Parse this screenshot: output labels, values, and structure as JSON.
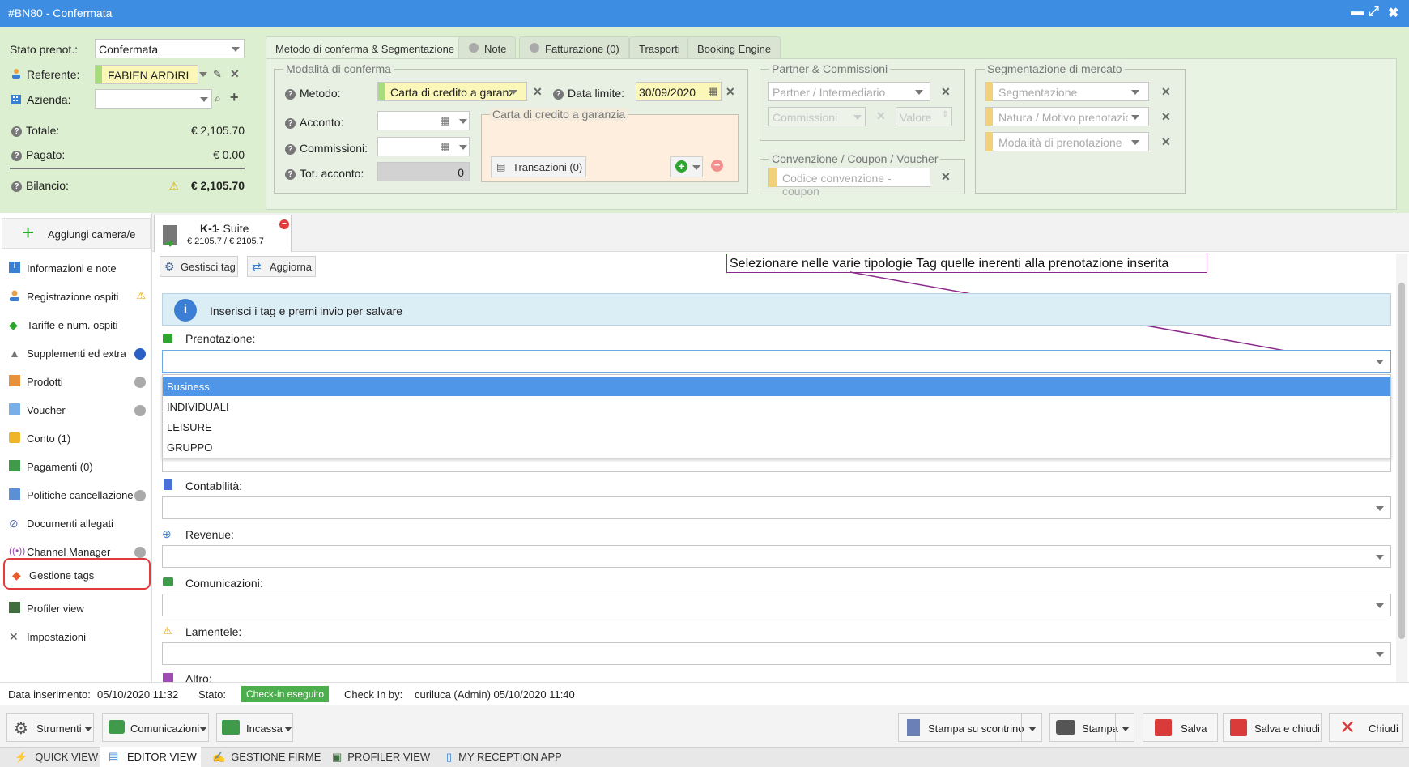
{
  "window": {
    "title": "#BN80 - Confermata",
    "min": "▬",
    "max": "⤢",
    "close": "✖"
  },
  "left_panel": {
    "stato_label": "Stato prenot.:",
    "stato_value": "Confermata",
    "referente_label": "Referente:",
    "referente_value": "FABIEN ARDIRI",
    "azienda_label": "Azienda:",
    "azienda_value": "",
    "totale_label": "Totale:",
    "totale_value": "€ 2,105.70",
    "pagato_label": "Pagato:",
    "pagato_value": "€ 0.00",
    "bilancio_label": "Bilancio:",
    "bilancio_value": "€ 2,105.70"
  },
  "tabs": [
    {
      "label": "Metodo di conferma & Segmentazione"
    },
    {
      "label": "Note"
    },
    {
      "label": "Fatturazione (0)"
    },
    {
      "label": "Trasporti"
    },
    {
      "label": "Booking Engine"
    }
  ],
  "conferma": {
    "legend": "Modalità di conferma",
    "metodo_label": "Metodo:",
    "metodo_value": "Carta di credito a garanzia",
    "data_limite_label": "Data limite:",
    "data_limite_value": "30/09/2020",
    "acconto_label": "Acconto:",
    "commissioni_label": "Commissioni:",
    "tot_acconto_label": "Tot. acconto:",
    "tot_acconto_value": "0",
    "carta_legend": "Carta di credito a garanzia",
    "transazioni_label": "Transazioni (0)"
  },
  "partner": {
    "legend": "Partner & Commissioni",
    "partner_placeholder": "Partner / Intermediario",
    "commissioni_placeholder": "Commissioni",
    "valore_placeholder": "Valore"
  },
  "convenzione": {
    "legend": "Convenzione / Coupon / Voucher",
    "codice_placeholder": "Codice convenzione - coupon"
  },
  "segmentazione": {
    "legend": "Segmentazione di mercato",
    "seg_placeholder": "Segmentazione",
    "natura_placeholder": "Natura / Motivo prenotazione",
    "modalita_placeholder": "Modalità di prenotazione"
  },
  "sidebar": {
    "add_room": "Aggiungi camera/e",
    "items": [
      {
        "label": "Informazioni e note"
      },
      {
        "label": "Registrazione ospiti"
      },
      {
        "label": "Tariffe e num. ospiti"
      },
      {
        "label": "Supplementi ed extra"
      },
      {
        "label": "Prodotti"
      },
      {
        "label": "Voucher"
      },
      {
        "label": "Conto (1)"
      },
      {
        "label": "Pagamenti (0)"
      },
      {
        "label": "Politiche cancellazione"
      },
      {
        "label": "Documenti allegati"
      },
      {
        "label": "Channel Manager"
      },
      {
        "label": "Gestione tags"
      },
      {
        "label": "Profiler view"
      },
      {
        "label": "Impostazioni"
      }
    ]
  },
  "room_tab": {
    "code": "K-1",
    "type": " - Suite",
    "price": "€ 2105.7 / € 2105.7"
  },
  "tags": {
    "gestisci_label": "Gestisci tag",
    "aggiorna_label": "Aggiorna",
    "annotation": "Selezionare nelle varie tipologie Tag quelle inerenti alla prenotazione inserita",
    "info": "Inserisci i tag e premi invio per salvare",
    "prenotazione_label": "Prenotazione:",
    "options": [
      "Business",
      "INDIVIDUALI",
      "LEISURE",
      "GRUPPO"
    ],
    "contabilita_label": "Contabilità:",
    "revenue_label": "Revenue:",
    "comunicazioni_label": "Comunicazioni:",
    "lamentele_label": "Lamentele:",
    "altro_label": "Altro:"
  },
  "status_bar": {
    "data_ins_label": "Data inserimento:",
    "data_ins_value": "05/10/2020 11:32",
    "stato_label": "Stato:",
    "stato_value": "Check-in eseguito",
    "checkin_label": "Check In by:",
    "checkin_value": "curiluca (Admin) 05/10/2020 11:40"
  },
  "footer": {
    "strumenti": "Strumenti",
    "comunicazioni": "Comunicazioni",
    "incassa": "Incassa",
    "stampa_scontrino": "Stampa su scontrino",
    "stampa": "Stampa",
    "salva": "Salva",
    "salva_chiudi": "Salva e chiudi",
    "chiudi": "Chiudi"
  },
  "bottom_tabs": [
    {
      "label": "QUICK VIEW"
    },
    {
      "label": "EDITOR VIEW"
    },
    {
      "label": "GESTIONE FIRME"
    },
    {
      "label": "PROFILER VIEW"
    },
    {
      "label": "MY RECEPTION APP"
    }
  ]
}
